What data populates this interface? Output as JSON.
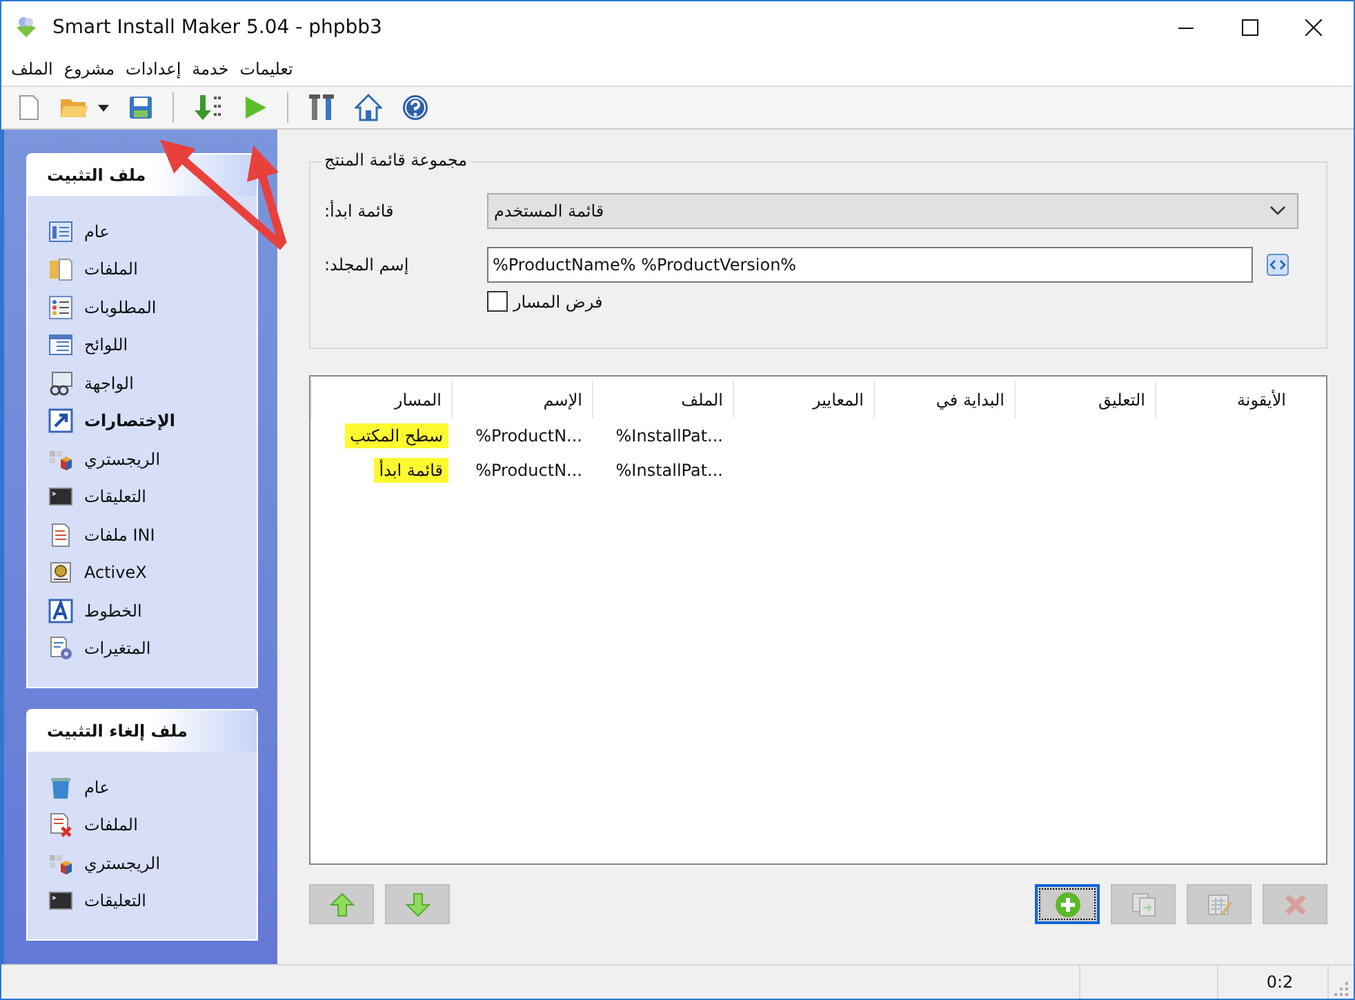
{
  "window": {
    "title": "Smart Install Maker 5.04 - phpbb3"
  },
  "menu": [
    "تعليمات",
    "خدمة",
    "إعدادات",
    "مشروع",
    "الملف"
  ],
  "sidebar": {
    "panels": [
      {
        "title": "ملف التثبيت",
        "items": [
          {
            "label": "عام",
            "selected": false
          },
          {
            "label": "الملفات",
            "selected": false
          },
          {
            "label": "المطلوبات",
            "selected": false
          },
          {
            "label": "اللوائح",
            "selected": false
          },
          {
            "label": "الواجهة",
            "selected": false
          },
          {
            "label": "الإختصارات",
            "selected": true
          },
          {
            "label": "الريجستري",
            "selected": false
          },
          {
            "label": "التعليقات",
            "selected": false
          },
          {
            "label": "ملفات INI",
            "selected": false
          },
          {
            "label": "ActiveX",
            "selected": false
          },
          {
            "label": "الخطوط",
            "selected": false
          },
          {
            "label": "المتغيرات",
            "selected": false
          }
        ]
      },
      {
        "title": "ملف إلغاء التثبيت",
        "items": [
          {
            "label": "عام",
            "selected": false
          },
          {
            "label": "الملفات",
            "selected": false
          },
          {
            "label": "الريجستري",
            "selected": false
          },
          {
            "label": "التعليقات",
            "selected": false
          }
        ]
      }
    ]
  },
  "group": {
    "title": "مجموعة قائمة المنتج",
    "start_menu": {
      "label": "قائمة ابدأ:",
      "value": "قائمة المستخدم"
    },
    "folder": {
      "label": "إسم المجلد:",
      "value": "%ProductName% %ProductVersion%"
    },
    "force_path": {
      "label": "فرض المسار",
      "checked": false
    }
  },
  "table": {
    "columns": [
      "الأيقونة",
      "التعليق",
      "البداية في",
      "المعايير",
      "الملف",
      "الإسم",
      "المسار"
    ],
    "rows": [
      {
        "file": "%InstallPat...",
        "name": "%ProductN...",
        "path": "سطح المكتب",
        "highlighted": true
      },
      {
        "file": "%InstallPat...",
        "name": "%ProductN...",
        "path": "قائمة ابدأ",
        "highlighted": true
      }
    ]
  },
  "buttons": [
    {
      "kind": "up",
      "disabled": false,
      "focused": false
    },
    {
      "kind": "down",
      "disabled": false,
      "focused": false
    },
    {
      "kind": "add",
      "disabled": false,
      "focused": true
    },
    {
      "kind": "copy",
      "disabled": true,
      "focused": false
    },
    {
      "kind": "edit",
      "disabled": true,
      "focused": false
    },
    {
      "kind": "delete",
      "disabled": true,
      "focused": false
    }
  ],
  "status_bar": {
    "text": "0:2"
  }
}
